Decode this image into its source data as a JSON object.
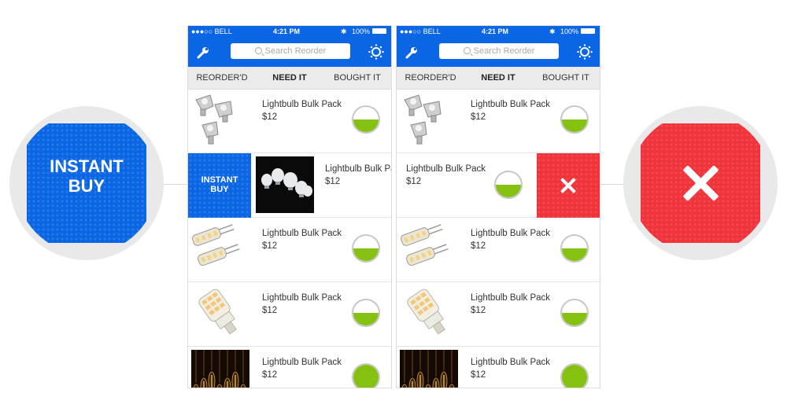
{
  "status_bar": {
    "carrier": "●●●○○ BELL",
    "time": "4:21 PM",
    "battery": "100%"
  },
  "search": {
    "placeholder": "Search Reorder"
  },
  "tabs": [
    "REORDER'D",
    "NEED IT",
    "BOUGHT IT"
  ],
  "active_tab": "NEED IT",
  "product": {
    "title": "Lightbulb Bulk Pack",
    "price": "$12"
  },
  "gauge_levels": [
    0.5,
    0.5,
    0.5,
    0.5,
    1.0
  ],
  "actions": {
    "instant_buy": "INSTANT BUY",
    "instant_buy_line1": "INSTANT",
    "instant_buy_line2": "BUY"
  },
  "zoom_left": {
    "line1": "INSTANT",
    "line2": "BUY"
  },
  "colors": {
    "brand_blue": "#0a66e4",
    "delete_red": "#f0343c",
    "gauge_green": "#84c111"
  },
  "icons": [
    "wrench-icon",
    "search-icon",
    "settings-icon",
    "close-icon"
  ]
}
